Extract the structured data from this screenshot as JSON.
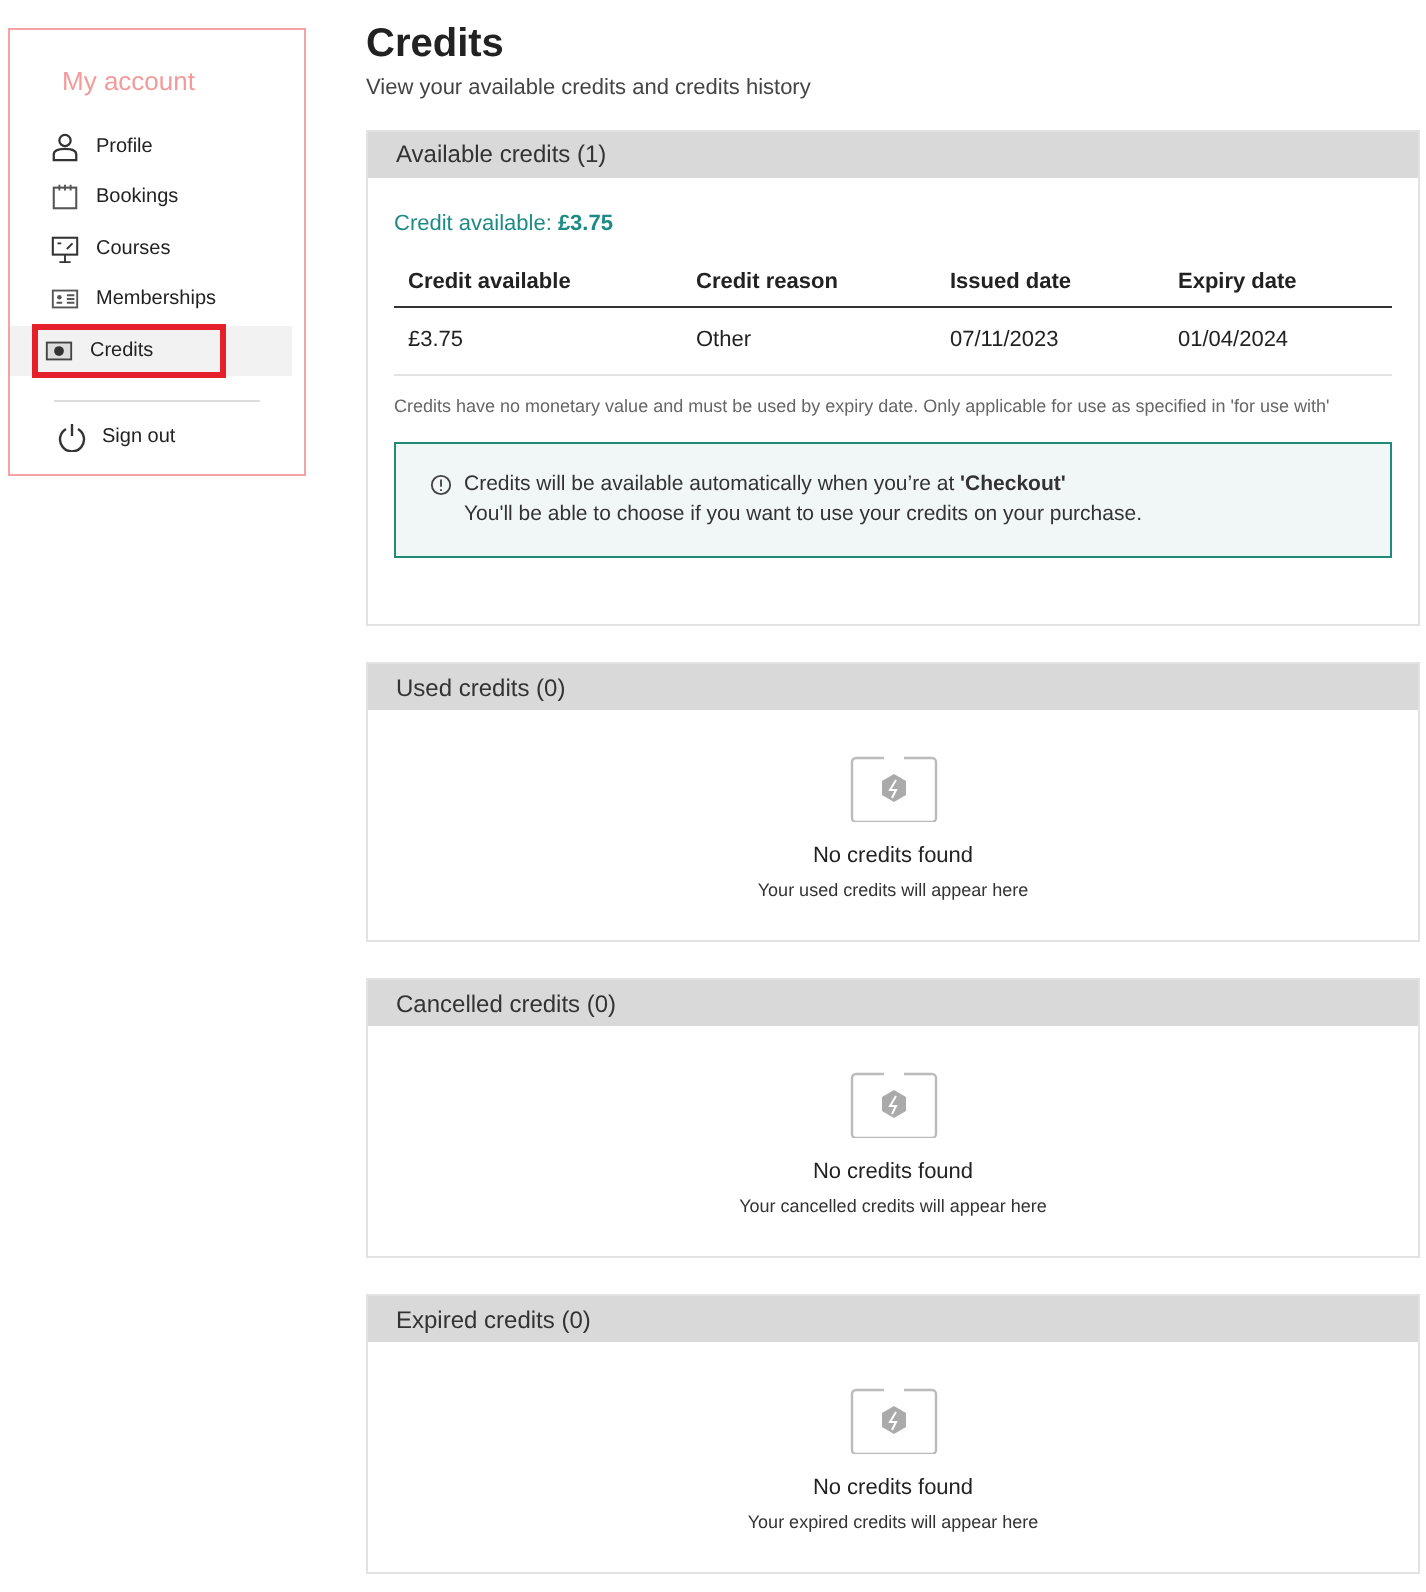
{
  "sidebar": {
    "title": "My account",
    "items": [
      {
        "label": "Profile",
        "kind": "person",
        "selected": false,
        "highlighted": false
      },
      {
        "label": "Bookings",
        "kind": "calendar",
        "selected": false,
        "highlighted": false
      },
      {
        "label": "Courses",
        "kind": "easel",
        "selected": false,
        "highlighted": false
      },
      {
        "label": "Memberships",
        "kind": "card",
        "selected": false,
        "highlighted": false
      },
      {
        "label": "Credits",
        "kind": "money",
        "selected": true,
        "highlighted": true
      }
    ],
    "sign_out": "Sign out"
  },
  "page": {
    "title": "Credits",
    "subtitle": "View your available credits and credits history"
  },
  "available": {
    "heading": "Available credits (1)",
    "summary": "Credit available: **£3.75**",
    "table": {
      "columns": [
        "Credit available",
        "Credit reason",
        "Issued date",
        "Expiry date"
      ],
      "rows": [
        [
          "£3.75",
          "Other",
          "07/11/2023",
          "01/04/2024"
        ]
      ]
    },
    "note": "Credits have no monetary value and must be used by expiry date. Only applicable for use as specified in 'for use with'",
    "info": [
      "Credits will be available automatically when you’re at **'Checkout'**",
      "You'll be able to choose if you want to use your credits on your purchase."
    ]
  },
  "empty_sections": [
    {
      "heading": "Used credits (0)",
      "title": "No credits found",
      "message": "Your used credits will appear here"
    },
    {
      "heading": "Cancelled credits (0)",
      "title": "No credits found",
      "message": "Your cancelled credits will appear here"
    },
    {
      "heading": "Expired credits (0)",
      "title": "No credits found",
      "message": "Your expired credits will appear here"
    }
  ]
}
